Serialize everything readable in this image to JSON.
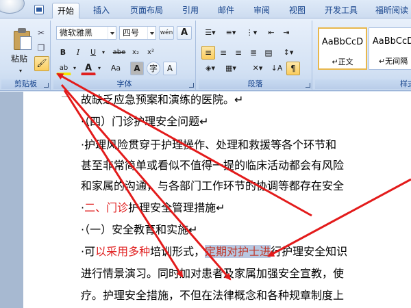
{
  "tabs": [
    {
      "label": "开始",
      "active": true
    },
    {
      "label": "插入"
    },
    {
      "label": "页面布局"
    },
    {
      "label": "引用"
    },
    {
      "label": "邮件"
    },
    {
      "label": "审阅"
    },
    {
      "label": "视图"
    },
    {
      "label": "开发工具"
    },
    {
      "label": "福昕阅读"
    }
  ],
  "ribbon": {
    "clipboard": {
      "label": "剪贴板",
      "paste_label": "粘贴",
      "cut_icon": "scissors-icon",
      "copy_icon": "copy-icon",
      "format_painter_icon": "format-painter-icon"
    },
    "font": {
      "label": "字体",
      "font_name": "微软雅黑",
      "font_size": "四号",
      "buttons": [
        "B",
        "I",
        "U",
        "abe",
        "x₂",
        "x²",
        "Aa",
        "A"
      ],
      "highlight_color": "#f5e400",
      "font_color": "#e02020"
    },
    "paragraph": {
      "label": "段落"
    },
    "styles": {
      "label": "样式",
      "items": [
        {
          "sample": "AaBbCcD",
          "name": "↵正文"
        },
        {
          "sample": "AaBbCcD",
          "name": "↵无间隔"
        }
      ]
    }
  },
  "document": {
    "lines": [
      {
        "text": "故缺乏应急预案和演练的医院。↵"
      },
      {
        "text": "·（四）门诊护理安全问题↵"
      },
      {
        "text": "·护理风险贯穿于护理操作、处理和救援等各个环节和"
      },
      {
        "text": "甚至非常简单或看似不值得一提的临床活动都会有风险"
      },
      {
        "text": "和家属的沟通，与各部门工作环节的协调等都存在安全"
      },
      {
        "prefix": "·",
        "red": "二、门诊",
        "rest": "护理安全管理措施↵"
      },
      {
        "text": "·（一）安全教育和实施↵"
      },
      {
        "prefix": "·可",
        "red": "以采用多种",
        "mid": "培训形式，",
        "highlight": "定期对护士进",
        "rest": "行护理安全知识"
      },
      {
        "text": "进行情景演习。同时加对患者及家属加强安全宣教，使"
      },
      {
        "text": "疗。护理安全措施，不但在法律概念和各种规章制度上"
      }
    ]
  },
  "colors": {
    "arrow": "#e31b1b",
    "ribbon_bg": "#dbe6f4",
    "tab_text": "#15428b"
  }
}
